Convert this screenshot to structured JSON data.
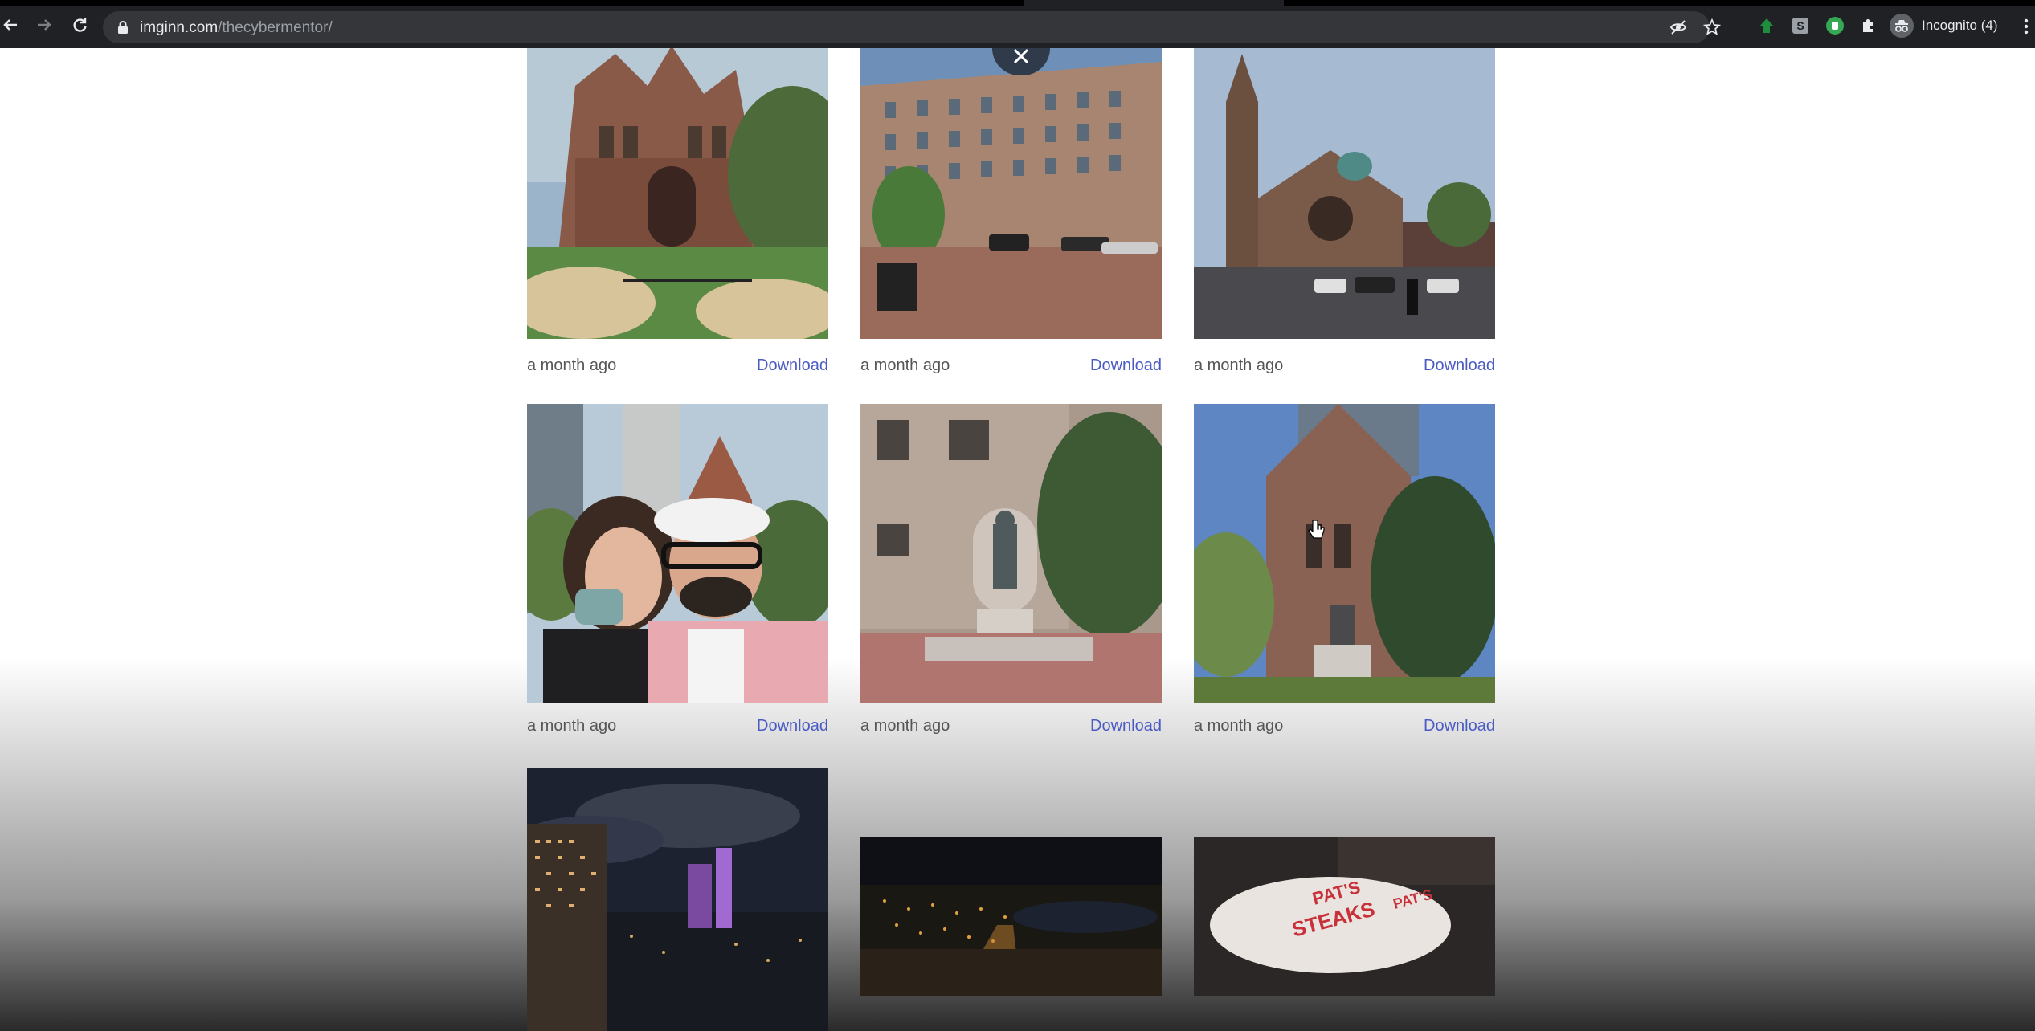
{
  "browser": {
    "url_host": "imginn.com",
    "url_path": "/thecybermentor/",
    "profile_label": "Incognito (4)"
  },
  "gallery": {
    "row1": [
      {
        "time": "a month ago",
        "download": "Download",
        "subject": "church facade with flowers"
      },
      {
        "time": "a month ago",
        "download": "Download",
        "subject": "hotel building street"
      },
      {
        "time": "a month ago",
        "download": "Download",
        "subject": "old south church"
      }
    ],
    "row2": [
      {
        "time": "a month ago",
        "download": "Download",
        "subject": "couple selfie"
      },
      {
        "time": "a month ago",
        "download": "Download",
        "subject": "statue in front of building"
      },
      {
        "time": "a month ago",
        "download": "Download",
        "subject": "church with statue"
      }
    ],
    "row3": [
      {
        "subject": "night skyline"
      },
      {
        "subject": "night city lights"
      },
      {
        "subject": "sandwich wrapper"
      }
    ]
  },
  "colors": {
    "link": "#4a5bc4",
    "chrome_bg": "#202124"
  }
}
